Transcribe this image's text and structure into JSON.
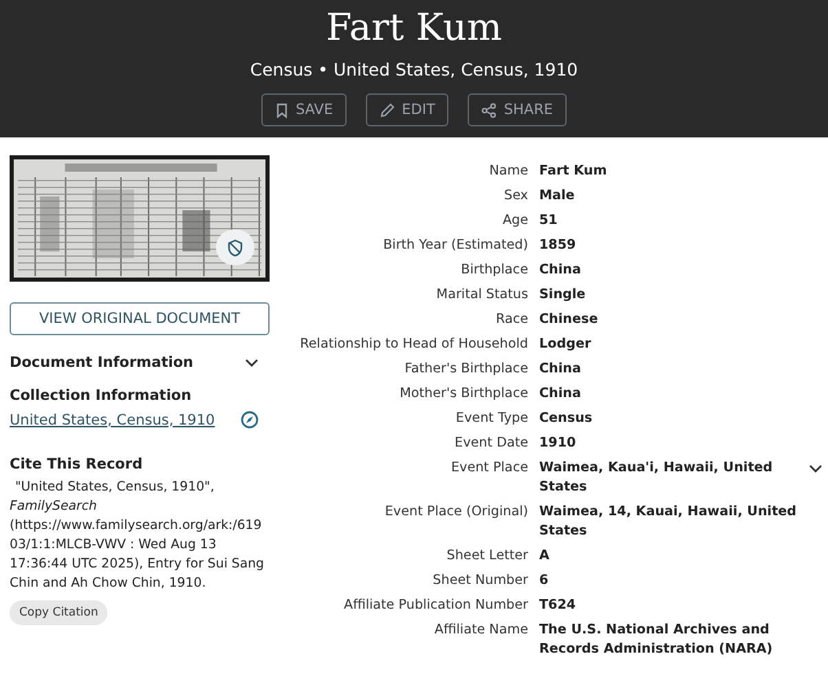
{
  "header": {
    "title": "Fart Kum",
    "subtitle": "Census • United States, Census, 1910",
    "actions": [
      {
        "kind": "save",
        "label": "SAVE"
      },
      {
        "kind": "edit",
        "label": "EDIT"
      },
      {
        "kind": "share",
        "label": "SHARE"
      }
    ]
  },
  "sidebar": {
    "view_button": "VIEW ORIGINAL DOCUMENT",
    "document_information": "Document Information",
    "collection_heading": "Collection Information",
    "collection_link": "United States, Census, 1910",
    "cite_heading": "Cite This Record",
    "citation": "\"United States, Census, 1910\", *FamilySearch* (https://www.familysearch.org/ark:/61903/1:1:MLCB-VWV : Wed Aug 13 17:36:44 UTC 2025), Entry for Sui Sang Chin and Ah Chow Chin, 1910.",
    "copy_button": "Copy Citation"
  },
  "facts": [
    {
      "label": "Name",
      "value": "Fart Kum",
      "expandable": false
    },
    {
      "label": "Sex",
      "value": "Male",
      "expandable": false
    },
    {
      "label": "Age",
      "value": "51",
      "expandable": false
    },
    {
      "label": "Birth Year (Estimated)",
      "value": "1859",
      "expandable": false
    },
    {
      "label": "Birthplace",
      "value": "China",
      "expandable": false
    },
    {
      "label": "Marital Status",
      "value": "Single",
      "expandable": false
    },
    {
      "label": "Race",
      "value": "Chinese",
      "expandable": false
    },
    {
      "label": "Relationship to Head of Household",
      "value": "Lodger",
      "expandable": false
    },
    {
      "label": "Father's Birthplace",
      "value": "China",
      "expandable": false
    },
    {
      "label": "Mother's Birthplace",
      "value": "China",
      "expandable": false
    },
    {
      "label": "Event Type",
      "value": "Census",
      "expandable": false
    },
    {
      "label": "Event Date",
      "value": "1910",
      "expandable": false
    },
    {
      "label": "Event Place",
      "value": "Waimea, Kaua'i, Hawaii, United States",
      "expandable": true
    },
    {
      "label": "Event Place (Original)",
      "value": "Waimea, 14, Kauai, Hawaii, United States",
      "expandable": false
    },
    {
      "label": "Sheet Letter",
      "value": "A",
      "expandable": false
    },
    {
      "label": "Sheet Number",
      "value": "6",
      "expandable": false
    },
    {
      "label": "Affiliate Publication Number",
      "value": "T624",
      "expandable": false
    },
    {
      "label": "Affiliate Name",
      "value": "The U.S. National Archives and Records Administration (NARA)",
      "expandable": false
    }
  ]
}
